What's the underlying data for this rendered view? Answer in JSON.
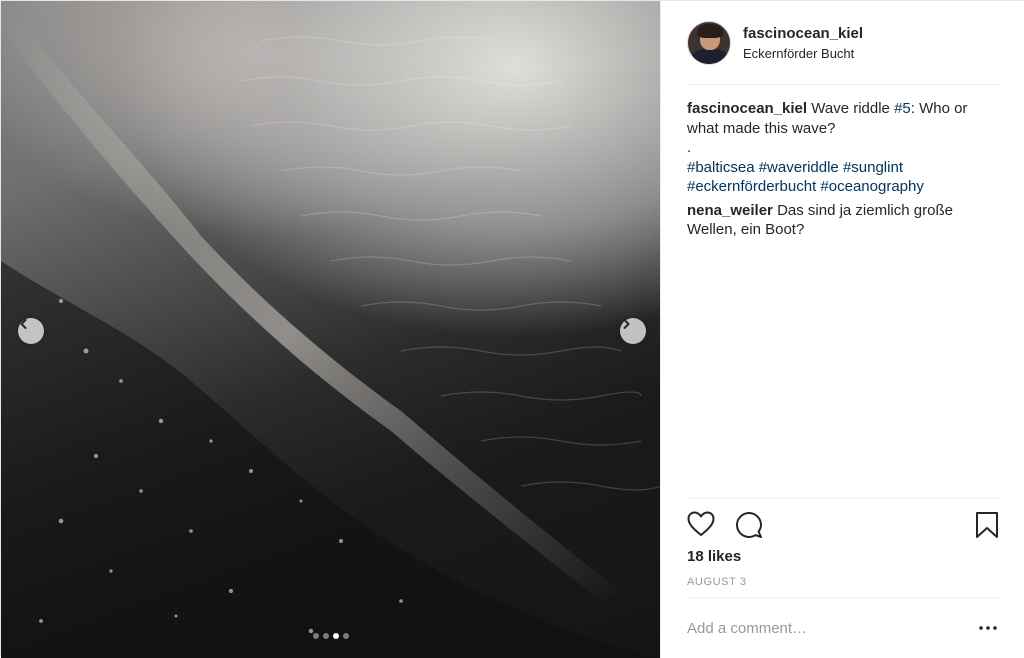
{
  "post": {
    "username": "fascinocean_kiel",
    "location": "Eckernförder Bucht",
    "caption": {
      "author": "fascinocean_kiel",
      "text_before": "Wave riddle ",
      "tag_number": "#5",
      "text_after": ": Who or what made this wave?",
      "separator": ".",
      "hashtags": [
        "#balticsea",
        "#waveriddle",
        "#sunglint",
        "#eckernförderbucht",
        "#oceanography"
      ]
    },
    "comments": [
      {
        "author": "nena_weiler",
        "text": "Das sind ja ziemlich große Wellen, ein Boot?"
      }
    ],
    "likes": "18 likes",
    "date": "AUGUST 3",
    "add_comment_placeholder": "Add a comment…",
    "carousel": {
      "count": 4,
      "active_index": 2
    }
  },
  "icons": {
    "prev": "chevron-left-icon",
    "next": "chevron-right-icon",
    "like": "heart-icon",
    "comment": "speech-bubble-icon",
    "save": "bookmark-icon",
    "more": "ellipsis-icon"
  },
  "colors": {
    "text": "#262626",
    "hashtag": "#003569",
    "muted": "#999999",
    "divider": "#efefef"
  }
}
